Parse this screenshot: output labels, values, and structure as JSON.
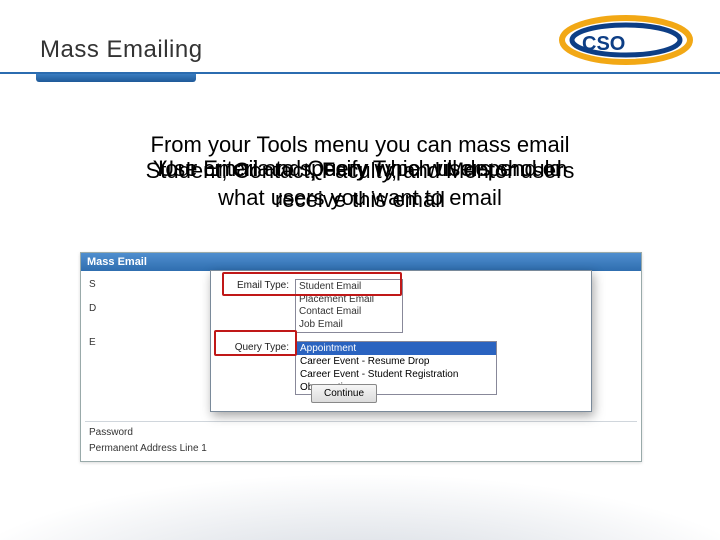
{
  "title": "Mass Emailing",
  "logo_text": "CSO",
  "body_layers": [
    "From your Tools menu you can mass email",
    "Use criteria to specify which users should",
    "Your Email and Query Type will depend on",
    "Student, Contact, Faculty, and Mentor users",
    "what users you want to email",
    "receive this email"
  ],
  "panel": {
    "header": "Mass Email",
    "left_labels": {
      "l1": "S",
      "l2": "D",
      "l3": "E",
      "l4": "Password",
      "l5": "Permanent Address Line 1"
    }
  },
  "flyout": {
    "email_type_label": "Email Type:",
    "email_type_options": [
      "Student Email",
      "Placement Email",
      "Contact Email",
      "Job Email"
    ],
    "query_type_label": "Query Type:",
    "query_type_options": [
      "Appointment",
      "Career Event - Resume Drop",
      "Career Event - Student Registration",
      "Observation"
    ],
    "continue_label": "Continue"
  }
}
